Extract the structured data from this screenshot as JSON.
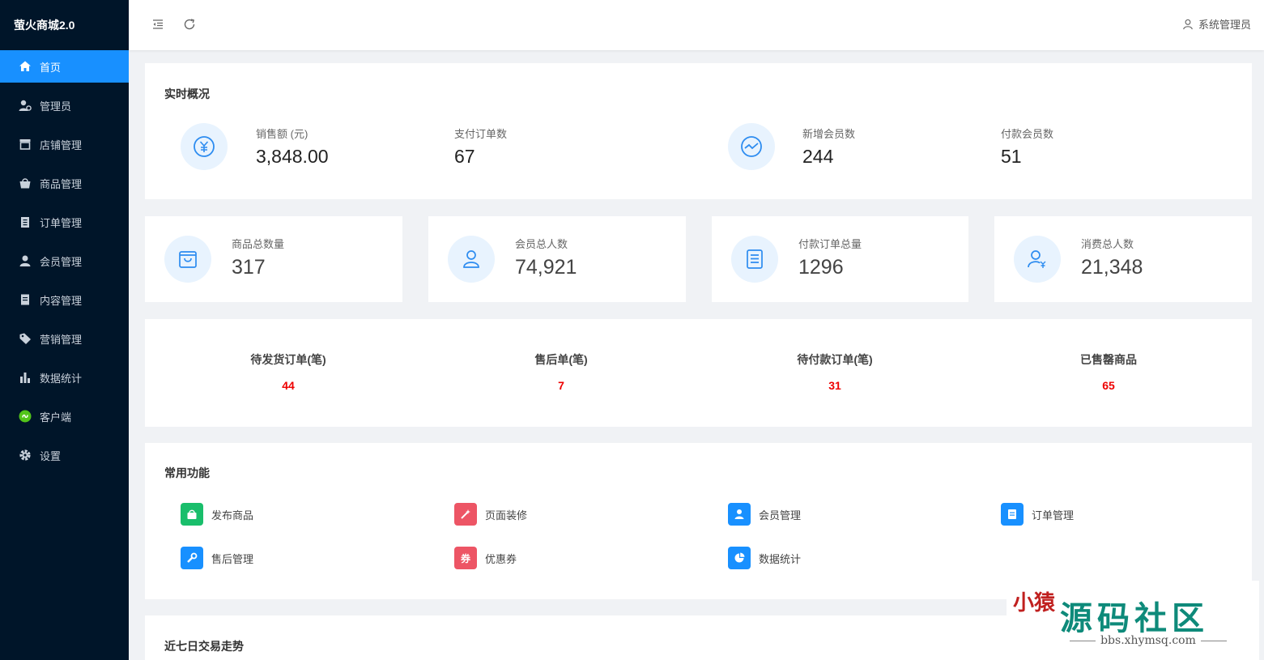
{
  "brand": "萤火商城2.0",
  "sidebar": {
    "items": [
      {
        "label": "首页",
        "icon": "home-icon"
      },
      {
        "label": "管理员",
        "icon": "admin-user-icon"
      },
      {
        "label": "店铺管理",
        "icon": "store-icon"
      },
      {
        "label": "商品管理",
        "icon": "basket-icon"
      },
      {
        "label": "订单管理",
        "icon": "clipboard-icon"
      },
      {
        "label": "会员管理",
        "icon": "user-icon"
      },
      {
        "label": "内容管理",
        "icon": "document-icon"
      },
      {
        "label": "营销管理",
        "icon": "tag-icon"
      },
      {
        "label": "数据统计",
        "icon": "bar-chart-icon"
      },
      {
        "label": "客户端",
        "icon": "mini-program-icon"
      },
      {
        "label": "设置",
        "icon": "gear-icon"
      }
    ]
  },
  "header": {
    "user": "系统管理员"
  },
  "overview": {
    "title": "实时概况",
    "items": [
      {
        "label": "销售额 (元)",
        "value": "3,848.00"
      },
      {
        "label": "支付订单数",
        "value": "67"
      },
      {
        "label": "新增会员数",
        "value": "244"
      },
      {
        "label": "付款会员数",
        "value": "51"
      }
    ]
  },
  "stats": [
    {
      "label": "商品总数量",
      "value": "317",
      "icon": "shopping-bag-icon"
    },
    {
      "label": "会员总人数",
      "value": "74,921",
      "icon": "person-icon"
    },
    {
      "label": "付款订单总量",
      "value": "1296",
      "icon": "list-icon"
    },
    {
      "label": "消费总人数",
      "value": "21,348",
      "icon": "person-yuan-icon"
    }
  ],
  "pending": [
    {
      "label": "待发货订单(笔)",
      "value": "44"
    },
    {
      "label": "售后单(笔)",
      "value": "7"
    },
    {
      "label": "待付款订单(笔)",
      "value": "31"
    },
    {
      "label": "已售罄商品",
      "value": "65"
    }
  ],
  "quick": {
    "title": "常用功能",
    "items": [
      {
        "label": "发布商品",
        "color": "#19be6b",
        "icon": "bag-icon"
      },
      {
        "label": "页面装修",
        "color": "#ed5565",
        "icon": "magic-wand-icon"
      },
      {
        "label": "会员管理",
        "color": "#1890ff",
        "icon": "member-icon"
      },
      {
        "label": "订单管理",
        "color": "#1890ff",
        "icon": "order-icon"
      },
      {
        "label": "售后管理",
        "color": "#1890ff",
        "icon": "wrench-icon"
      },
      {
        "label": "优惠券",
        "color": "#ed5565",
        "icon_text": "券"
      },
      {
        "label": "数据统计",
        "color": "#1890ff",
        "icon": "pie-chart-icon"
      }
    ]
  },
  "trend": {
    "title": "近七日交易走势"
  },
  "watermark": {
    "seal": "小猿",
    "text": "源码社区",
    "url": "bbs.xhymsq.com"
  },
  "colors": {
    "sidebar_bg": "#001529",
    "active": "#1890ff",
    "highlight": "#ee0000"
  }
}
